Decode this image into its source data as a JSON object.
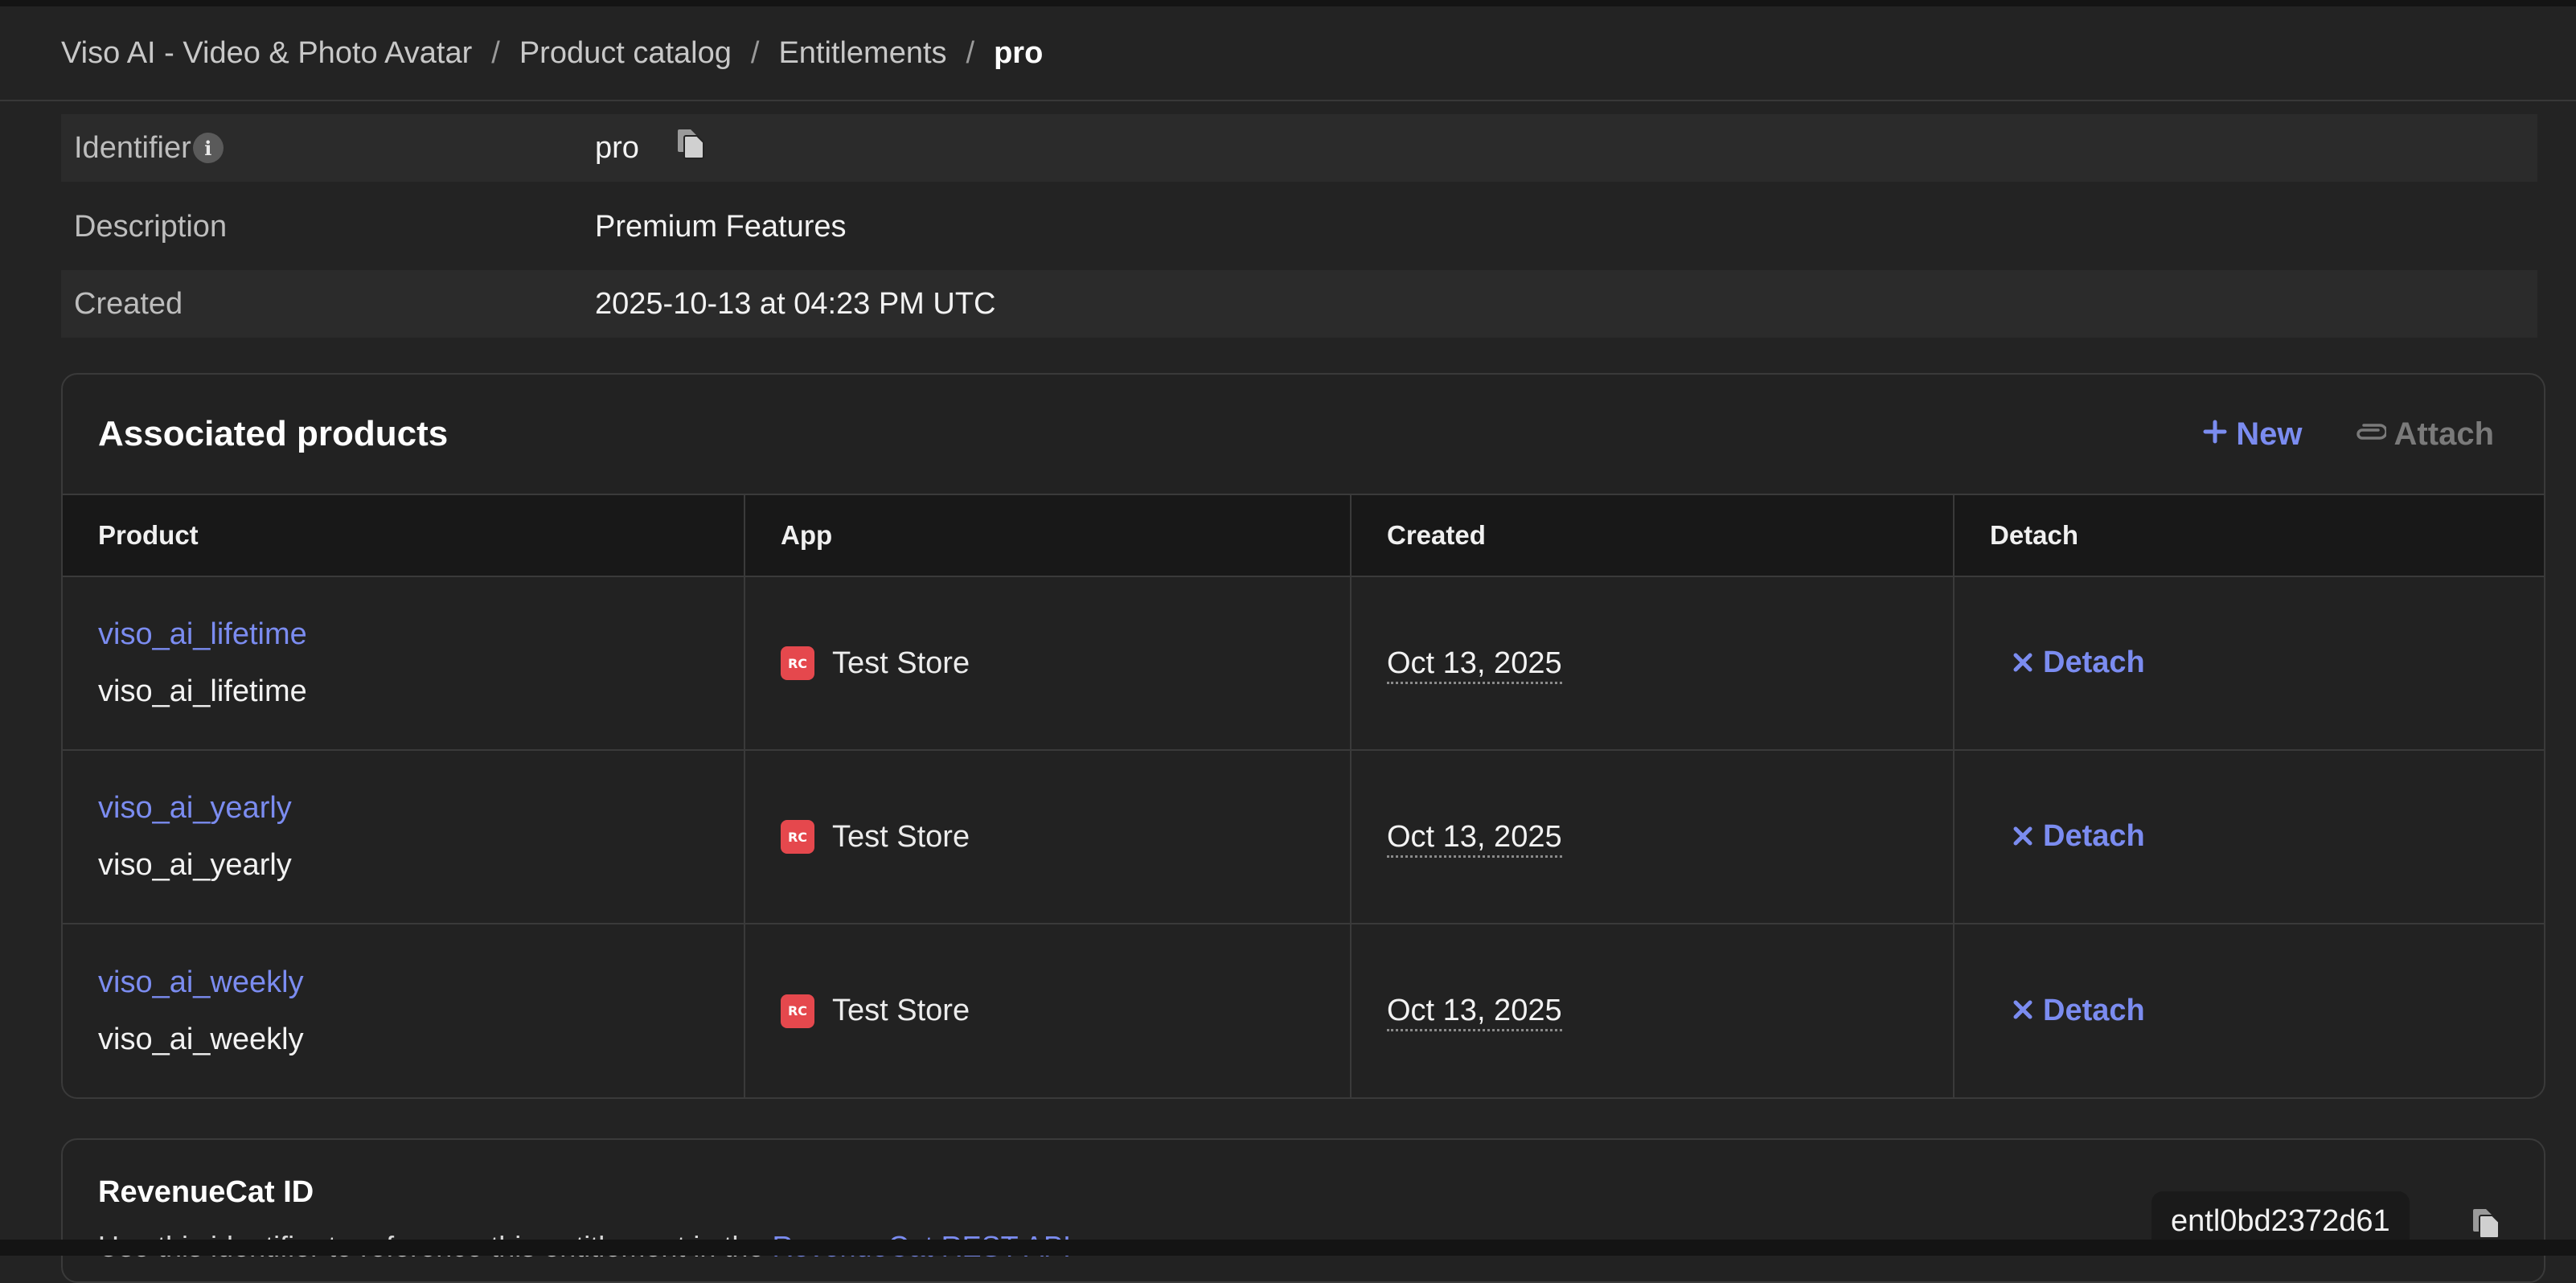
{
  "breadcrumb": {
    "items": [
      "Viso AI - Video & Photo Avatar",
      "Product catalog",
      "Entitlements"
    ],
    "separator": "/",
    "current": "pro"
  },
  "details": {
    "identifier_label": "Identifier",
    "identifier_value": "pro",
    "description_label": "Description",
    "description_value": "Premium Features",
    "created_label": "Created",
    "created_value": "2025-10-13 at 04:23 PM UTC"
  },
  "associated_products": {
    "title": "Associated products",
    "new_label": "New",
    "attach_label": "Attach",
    "columns": [
      "Product",
      "App",
      "Created",
      "Detach"
    ],
    "rows": [
      {
        "product_link": "viso_ai_lifetime",
        "product_id": "viso_ai_lifetime",
        "app": "Test Store",
        "created": "Oct 13, 2025",
        "detach": "Detach"
      },
      {
        "product_link": "viso_ai_yearly",
        "product_id": "viso_ai_yearly",
        "app": "Test Store",
        "created": "Oct 13, 2025",
        "detach": "Detach"
      },
      {
        "product_link": "viso_ai_weekly",
        "product_id": "viso_ai_weekly",
        "app": "Test Store",
        "created": "Oct 13, 2025",
        "detach": "Detach"
      }
    ]
  },
  "revenuecat": {
    "title": "RevenueCat ID",
    "description_prefix": "Use this identifier to reference this entitlement in the ",
    "description_link": "RevenueCat REST API",
    "id_value": "entl0bd2372d61"
  },
  "icons": {
    "copy": "copy-icon",
    "info": "info-icon",
    "plus": "plus-icon",
    "paperclip": "paperclip-icon",
    "close": "close-icon",
    "store": "test-store-icon"
  },
  "colors": {
    "background": "#232323",
    "accent": "#7b8cf0",
    "store_badge": "#e5484d"
  }
}
